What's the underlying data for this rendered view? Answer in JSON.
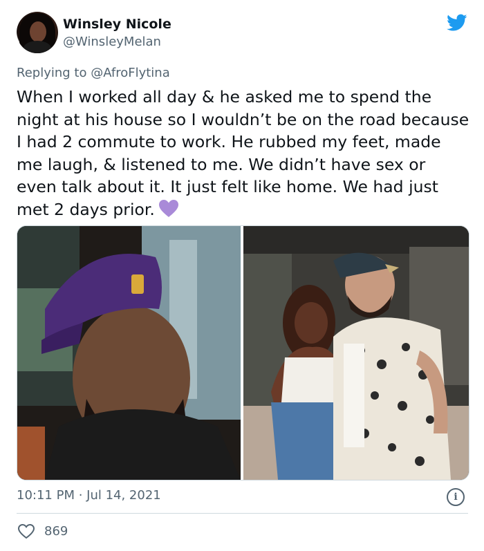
{
  "tweet": {
    "author_name": "Winsley Nicole",
    "author_handle": "@WinsleyMelan",
    "replying_prefix": "Replying to ",
    "replying_to": "@AfroFlytina",
    "text": "When I worked all day & he asked me to spend the night at his house so I wouldn’t be on the road because I had 2 commute to work. He rubbed my feet, made me laugh, & listened to me. We didn’t have sex or even talk about it. It just felt like home. We had just met 2 days prior.",
    "emoji": "purple-heart",
    "timestamp": "10:11 PM · Jul 14, 2021",
    "like_count": "869",
    "info_glyph": "i"
  },
  "icons": {
    "brand": "twitter-bird-icon",
    "like": "heart-outline-icon",
    "info": "info-icon"
  },
  "colors": {
    "brand_blue": "#1d9bf0",
    "secondary_text": "#536471",
    "purple_heart": "#a98ad8"
  },
  "media": [
    {
      "label": "photo-man-purple-cap"
    },
    {
      "label": "photo-couple-standing"
    }
  ]
}
